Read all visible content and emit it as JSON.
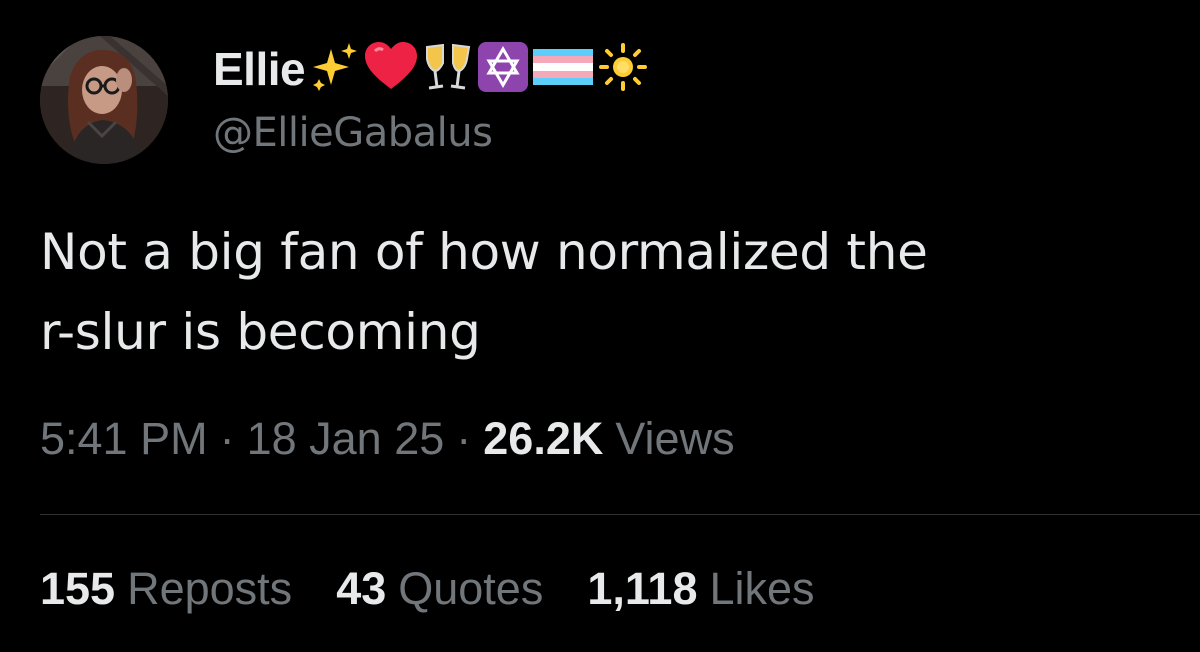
{
  "author": {
    "display_name": "Ellie",
    "handle": "@EllieGabalus",
    "name_emojis": [
      "sparkles-emoji",
      "red-heart-emoji",
      "clinking-glasses-emoji",
      "star-of-david-emoji",
      "transgender-flag-emoji",
      "sun-emoji"
    ]
  },
  "tweet": {
    "text_line1": "Not a big fan of how normalized the",
    "text_line2": "r-slur is becoming"
  },
  "meta": {
    "time": "5:41 PM",
    "separator": "·",
    "date": "18 Jan 25",
    "views_count": "26.2K",
    "views_label": "Views"
  },
  "stats": {
    "reposts_count": "155",
    "reposts_label": "Reposts",
    "quotes_count": "43",
    "quotes_label": "Quotes",
    "likes_count": "1,118",
    "likes_label": "Likes"
  },
  "colors": {
    "background": "#000000",
    "primary_text": "#e7e9ea",
    "secondary_text": "#71767b",
    "divider": "#2f3336"
  }
}
